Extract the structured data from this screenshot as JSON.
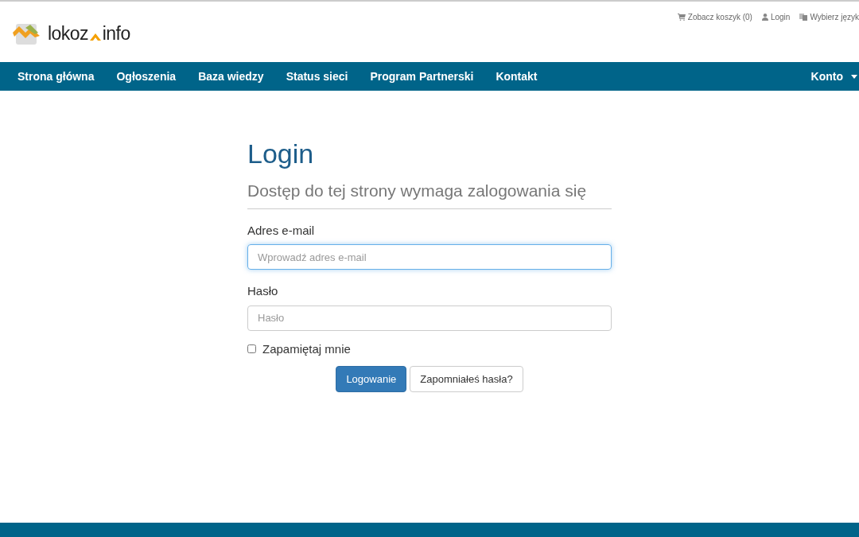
{
  "header": {
    "logo": {
      "left": "lokoz",
      "right": "info"
    },
    "top_links": [
      {
        "kind": "cart",
        "label": "Zobacz koszyk (0)"
      },
      {
        "kind": "user",
        "label": "Login"
      },
      {
        "kind": "language",
        "label": "Wybierz język"
      }
    ]
  },
  "nav": {
    "items": [
      {
        "label": "Strona główna"
      },
      {
        "label": "Ogłoszenia"
      },
      {
        "label": "Baza wiedzy"
      },
      {
        "label": "Status sieci"
      },
      {
        "label": "Program Partnerski"
      },
      {
        "label": "Kontakt"
      }
    ],
    "account": {
      "label": "Konto"
    }
  },
  "login": {
    "title": "Login",
    "subtitle": "Dostęp do tej strony wymaga zalogowania się",
    "fields": [
      {
        "label": "Adres e-mail",
        "placeholder": "Wprowadź adres e-mail",
        "focused": true
      },
      {
        "label": "Hasło",
        "placeholder": "Hasło",
        "focused": false
      }
    ],
    "remember": {
      "label": "Zapamiętaj mnie",
      "checked": false
    },
    "buttons": [
      {
        "kind": "primary",
        "label": "Logowanie"
      },
      {
        "kind": "default",
        "label": "Zapomniałeś hasła?"
      }
    ]
  }
}
